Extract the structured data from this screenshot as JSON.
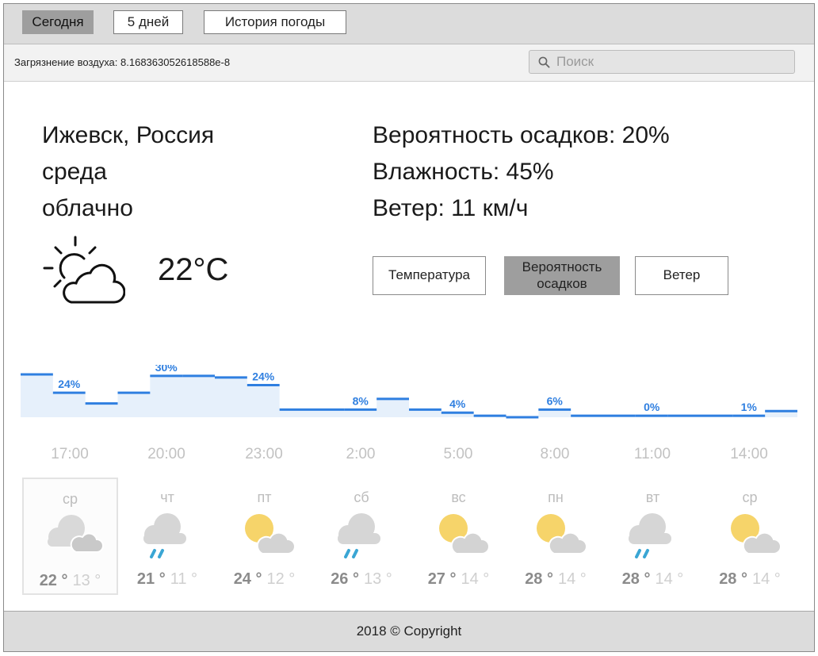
{
  "tabs": [
    {
      "label": "Сегодня",
      "active": true
    },
    {
      "label": "5 дней",
      "active": false
    },
    {
      "label": "История погоды",
      "active": false
    }
  ],
  "pollution": "Загрязнение воздуха: 8.168363052618588e-8",
  "search": {
    "placeholder": "Поиск",
    "icon": "search-icon"
  },
  "current": {
    "city": "Ижевск, Россия",
    "weekday": "среда",
    "condition": "облачно",
    "temperature": "22°C",
    "icon": "partly-cloudy-outline-icon",
    "precipitation": "Вероятность осадков: 20%",
    "humidity": "Влажность: 45%",
    "wind": "Ветер: 11 км/ч"
  },
  "chart_buttons": [
    {
      "label": "Температура",
      "active": false
    },
    {
      "label": "Вероятность осадков",
      "active": true
    },
    {
      "label": "Ветер",
      "active": false
    }
  ],
  "colors": {
    "accent": "#2f7fe0",
    "area": "#e6f0fb",
    "active_tab": "#9e9e9e",
    "sun": "#f6d46a"
  },
  "chart_data": {
    "type": "line",
    "steps": [
      28,
      16,
      9,
      16,
      27,
      27,
      26,
      21,
      5,
      5,
      5,
      12,
      5,
      3,
      1,
      0,
      5,
      1,
      1,
      1,
      1,
      1,
      1,
      4
    ],
    "labels": [
      {
        "step": 1,
        "text": "24%"
      },
      {
        "step": 4,
        "text": "30%"
      },
      {
        "step": 7,
        "text": "24%"
      },
      {
        "step": 10,
        "text": "8%"
      },
      {
        "step": 13,
        "text": "4%"
      },
      {
        "step": 16,
        "text": "6%"
      },
      {
        "step": 19,
        "text": "0%"
      },
      {
        "step": 22,
        "text": "1%"
      }
    ],
    "hours": [
      "17:00",
      "20:00",
      "23:00",
      "2:00",
      "5:00",
      "8:00",
      "11:00",
      "14:00"
    ]
  },
  "days": [
    {
      "name": "ср",
      "hi": "22 °",
      "lo": "13 °",
      "icon": "cloudy-icon",
      "selected": true
    },
    {
      "name": "чт",
      "hi": "21 °",
      "lo": "11 °",
      "icon": "cloud-rain-icon",
      "selected": false
    },
    {
      "name": "пт",
      "hi": "24 °",
      "lo": "12 °",
      "icon": "sun-cloud-icon",
      "selected": false
    },
    {
      "name": "сб",
      "hi": "26 °",
      "lo": "13 °",
      "icon": "cloud-rain-icon",
      "selected": false
    },
    {
      "name": "вс",
      "hi": "27 °",
      "lo": "14 °",
      "icon": "sun-cloud-icon",
      "selected": false
    },
    {
      "name": "пн",
      "hi": "28 °",
      "lo": "14 °",
      "icon": "sun-cloud-icon",
      "selected": false
    },
    {
      "name": "вт",
      "hi": "28 °",
      "lo": "14 °",
      "icon": "cloud-rain-icon",
      "selected": false
    },
    {
      "name": "ср",
      "hi": "28 °",
      "lo": "14 °",
      "icon": "sun-cloud-icon",
      "selected": false
    }
  ],
  "footer": "2018 © Copyright"
}
